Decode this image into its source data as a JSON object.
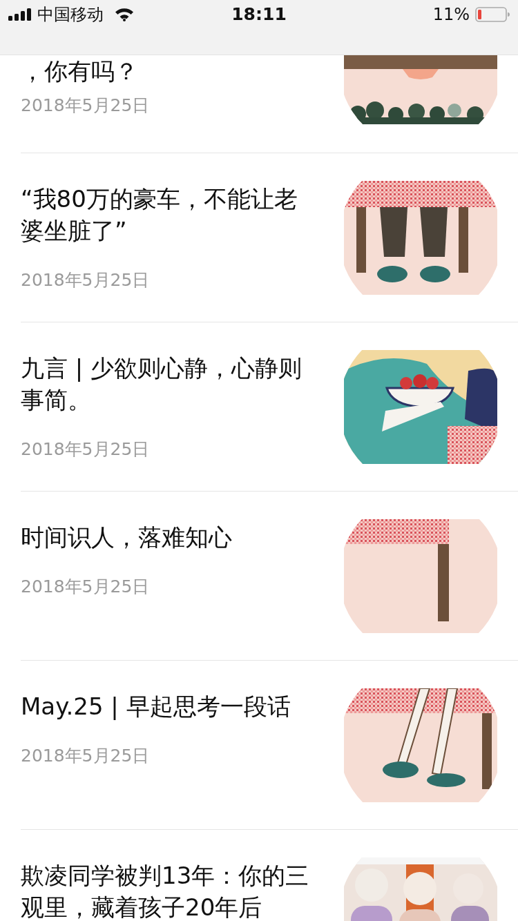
{
  "status_bar": {
    "carrier": "中国移动",
    "time": "18:11",
    "battery": "11%"
  },
  "articles": [
    {
      "kind": "partial",
      "title": "，你有吗？",
      "date": "2018年5月25日"
    },
    {
      "kind": "full",
      "title": "“我80万的豪车，不能让老婆坐脏了”",
      "date": "2018年5月25日"
    },
    {
      "kind": "full",
      "title": "九言 | 少欲则心静，心静则事简。",
      "date": "2018年5月25日"
    },
    {
      "kind": "full",
      "title": "时间识人，落难知心",
      "date": "2018年5月25日"
    },
    {
      "kind": "full",
      "title": "May.25 | 早起思考一段话",
      "date": "2018年5月25日"
    },
    {
      "kind": "full",
      "title": "欺凌同学被判13年：你的三观里，藏着孩子20年后"
    }
  ]
}
